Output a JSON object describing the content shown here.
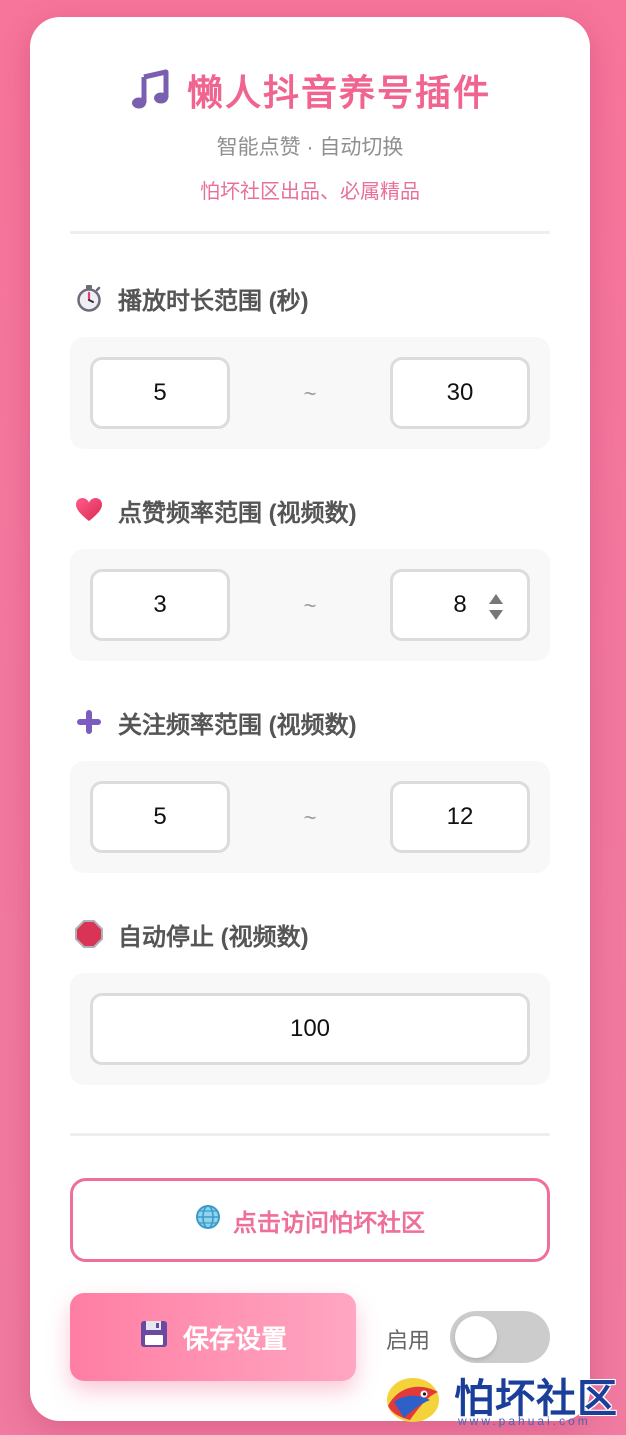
{
  "header": {
    "icon": "music-note-icon",
    "title": "懒人抖音养号插件",
    "subtitle": "智能点赞 · 自动切换",
    "tagline": "怕坏社区出品、必属精品"
  },
  "sections": {
    "play_duration": {
      "icon": "stopwatch-icon",
      "label": "播放时长范围 (秒)",
      "min": "5",
      "separator": "~",
      "max": "30"
    },
    "like_frequency": {
      "icon": "heart-icon",
      "label": "点赞频率范围 (视频数)",
      "min": "3",
      "separator": "~",
      "max": "8"
    },
    "follow_frequency": {
      "icon": "plus-icon",
      "label": "关注频率范围 (视频数)",
      "min": "5",
      "separator": "~",
      "max": "12"
    },
    "auto_stop": {
      "icon": "stop-sign-icon",
      "label": "自动停止 (视频数)",
      "value": "100"
    }
  },
  "actions": {
    "visit_icon": "globe-icon",
    "visit_label": "点击访问怕坏社区",
    "save_icon": "floppy-disk-icon",
    "save_label": "保存设置",
    "toggle_label": "启用",
    "toggle_on": false
  },
  "watermark": {
    "text": "怕坏社区",
    "url": "www.pahuai.com"
  },
  "colors": {
    "background": "#f5769c",
    "accent": "#f0648f",
    "toggle_off": "#cccccc"
  }
}
